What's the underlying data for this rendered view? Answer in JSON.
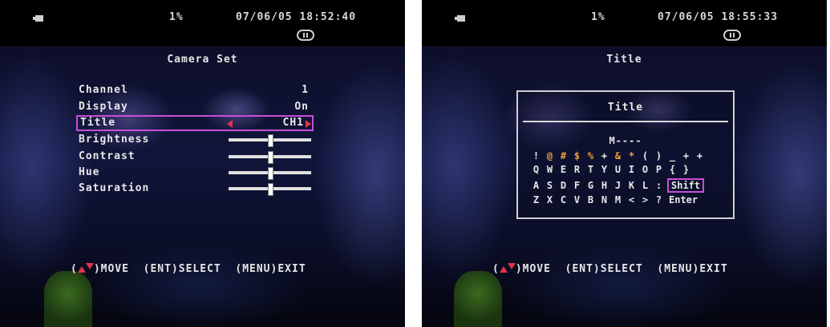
{
  "left": {
    "status": {
      "percent": "1%",
      "datetime": "07/06/05 18:52:40"
    },
    "heading": "Camera Set",
    "rows": [
      {
        "label": "Channel",
        "value": "1"
      },
      {
        "label": "Display",
        "value": "On"
      },
      {
        "label": "Title",
        "value": "CH1"
      },
      {
        "label": "Brightness",
        "level": 0.5
      },
      {
        "label": "Contrast",
        "level": 0.5
      },
      {
        "label": "Hue",
        "level": 0.5
      },
      {
        "label": "Saturation",
        "level": 0.5
      }
    ],
    "footer": {
      "move": ")MOVE",
      "select": "(ENT)SELECT",
      "exit": "(MENU)EXIT"
    }
  },
  "right": {
    "status": {
      "percent": "1%",
      "datetime": "07/06/05 18:55:33"
    },
    "heading": "Title",
    "dialog_title": "Title",
    "entry": "M----",
    "keyboard_rows": [
      [
        "!",
        "@",
        "#",
        "$",
        "%",
        "+",
        "&",
        "*",
        "(",
        ")",
        "_",
        "+",
        "+"
      ],
      [
        "Q",
        "W",
        "E",
        "R",
        "T",
        "Y",
        "U",
        "I",
        "O",
        "P",
        "{",
        "}"
      ],
      [
        "A",
        "S",
        "D",
        "F",
        "G",
        "H",
        "J",
        "K",
        "L",
        ":",
        "Shift"
      ],
      [
        "Z",
        "X",
        "C",
        "V",
        "B",
        "N",
        "M",
        "<",
        ">",
        "?",
        "Enter"
      ]
    ],
    "footer": {
      "move": ")MOVE",
      "select": "(ENT)SELECT",
      "exit": "(MENU)EXIT"
    }
  },
  "colors": {
    "selection": "#c84fd8",
    "arrow": "#e0344a",
    "text": "#e8e8e8",
    "symbol_highlight": "#f0a040"
  },
  "icons": [
    "battery-icon",
    "pause-icon",
    "up-arrow-icon",
    "down-arrow-icon"
  ]
}
